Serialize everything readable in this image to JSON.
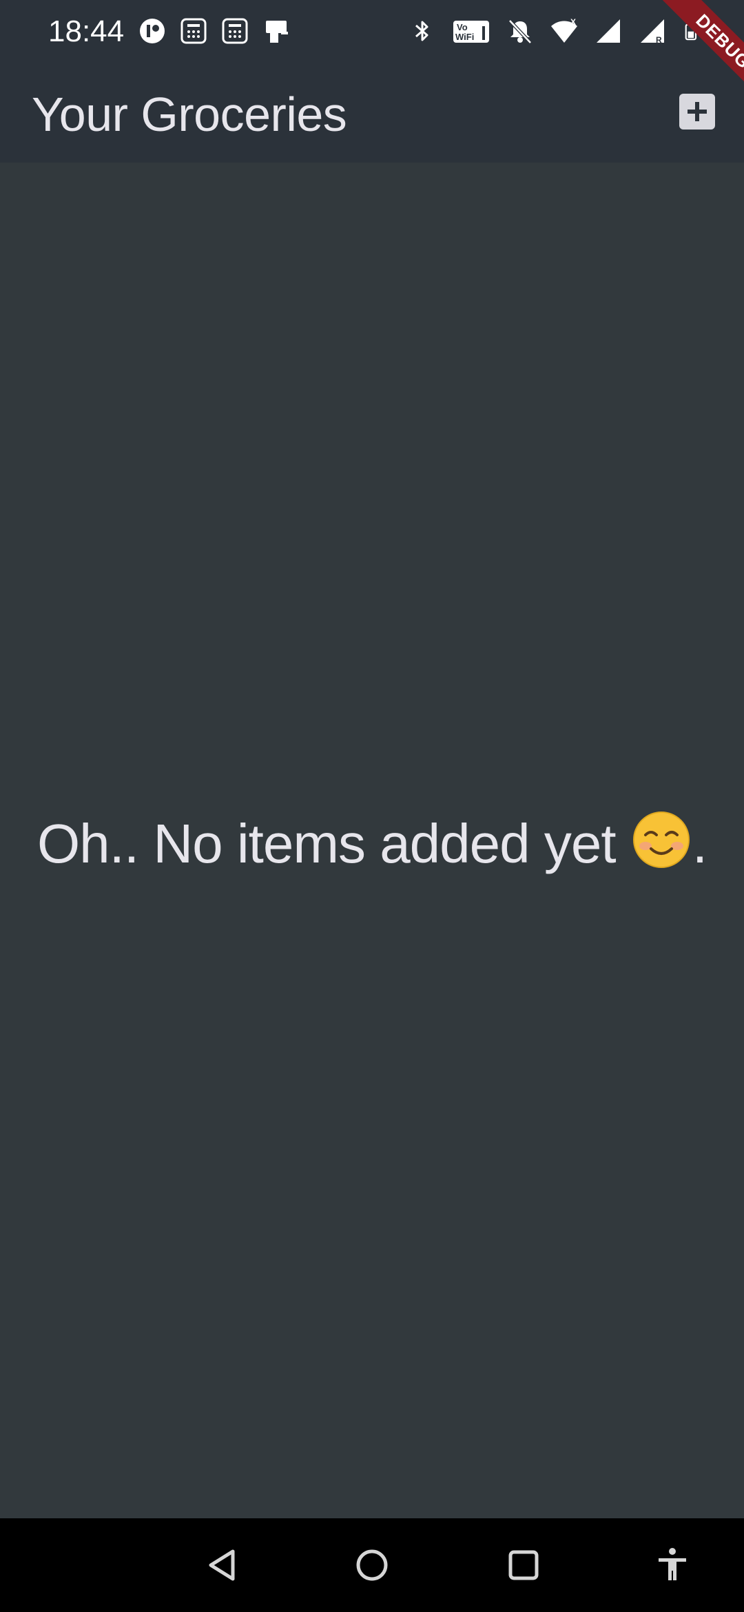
{
  "status_bar": {
    "time": "18:44",
    "left_icons": [
      "app-notification-icon",
      "calculator-icon",
      "calculator-icon",
      "card-payment-icon"
    ],
    "right_icons": [
      "bluetooth-icon",
      "vowifi-icon",
      "bell-muted-icon",
      "wifi-icon",
      "signal-icon",
      "signal-roaming-icon",
      "battery-icon"
    ],
    "vowifi_text": "Vo WiFi"
  },
  "app_bar": {
    "title": "Your Groceries",
    "add_icon": "plus-icon"
  },
  "debug_banner": {
    "label": "DEBUG",
    "color": "#8c1b22"
  },
  "content": {
    "empty_message": "Oh.. No items added yet",
    "empty_message_suffix": ".",
    "emoji": "smiling-face-emoji"
  },
  "nav_bar": {
    "buttons": [
      "back-icon",
      "home-icon",
      "recents-icon",
      "accessibility-icon"
    ]
  },
  "colors": {
    "app_bar_background": "#2b323a",
    "body_background": "#32393d",
    "text": "#e7e6ec",
    "nav_background": "#000000"
  }
}
